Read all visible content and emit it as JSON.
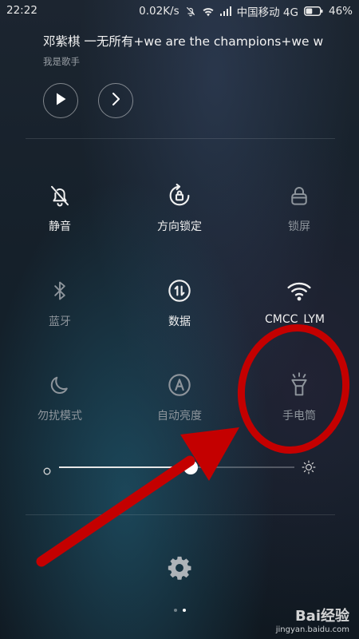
{
  "status_bar": {
    "time": "22:22",
    "speed": "0.02K/s",
    "carrier": "中国移动 4G",
    "battery": "46%",
    "battery_level": 0.46,
    "icons": [
      "alarm-off-icon",
      "wifi-icon",
      "signal-icon",
      "battery-icon"
    ]
  },
  "music": {
    "title": "邓紫棋 一无所有+we are the champions+we w",
    "artist": "我是歌手",
    "controls": [
      "play-icon",
      "next-icon"
    ]
  },
  "tiles": [
    {
      "label": "静音",
      "icon": "bell-off-icon",
      "active": true
    },
    {
      "label": "方向锁定",
      "icon": "rotation-lock-icon",
      "active": true
    },
    {
      "label": "锁屏",
      "icon": "lock-icon",
      "active": false
    },
    {
      "label": "蓝牙",
      "icon": "bluetooth-icon",
      "active": false
    },
    {
      "label": "数据",
      "icon": "data-icon",
      "active": true
    },
    {
      "label": "CMCC_LYM",
      "icon": "wifi-icon",
      "active": true
    },
    {
      "label": "勿扰模式",
      "icon": "moon-icon",
      "active": false
    },
    {
      "label": "自动亮度",
      "icon": "auto-brightness-icon",
      "active": false
    },
    {
      "label": "手电筒",
      "icon": "flashlight-icon",
      "active": false
    }
  ],
  "brightness": {
    "level": 0.56,
    "icons": [
      "brightness-low-icon",
      "brightness-high-icon"
    ]
  },
  "settings": {
    "icon": "gear-icon"
  },
  "pager": {
    "count": 2,
    "current": 1
  },
  "watermark": {
    "text": "Bai经验",
    "url": "jingyan.baidu.com"
  },
  "annotation": {
    "color": "#c40000"
  },
  "colors": {
    "active": "#f0f0f0",
    "inactive": "#8e959c"
  }
}
